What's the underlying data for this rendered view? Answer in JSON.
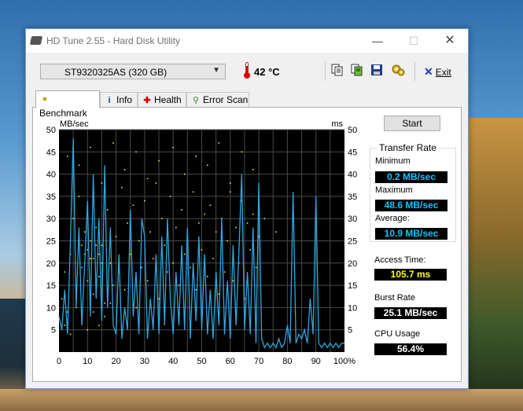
{
  "window": {
    "title": "HD Tune 2.55 - Hard Disk Utility",
    "min_glyph": "—",
    "max_glyph": "☐",
    "close_glyph": "✕"
  },
  "toolbar": {
    "drive": "ST9320325AS (320 GB)",
    "temperature": "42 °C",
    "exit_label": "Exit",
    "icons": [
      "copy-text-icon",
      "copy-screenshot-icon",
      "save-icon",
      "options-icon"
    ]
  },
  "tabs": [
    {
      "label": "Benchmark",
      "icon": "lightbulb-icon",
      "active": true
    },
    {
      "label": "Info",
      "icon": "info-icon",
      "active": false
    },
    {
      "label": "Health",
      "icon": "health-cross-icon",
      "active": false
    },
    {
      "label": "Error Scan",
      "icon": "magnifier-icon",
      "active": false
    }
  ],
  "benchmark": {
    "start_label": "Start",
    "transfer_rate_title": "Transfer Rate",
    "minimum_label": "Minimum",
    "minimum_value": "0.2 MB/sec",
    "maximum_label": "Maximum",
    "maximum_value": "48.6 MB/sec",
    "average_label": "Average:",
    "average_value": "10.9 MB/sec",
    "access_time_label": "Access Time:",
    "access_time_value": "105.7 ms",
    "burst_rate_label": "Burst Rate",
    "burst_rate_value": "25.1 MB/sec",
    "cpu_usage_label": "CPU Usage",
    "cpu_usage_value": "56.4%"
  },
  "colors": {
    "transfer_line": "#2ea8e0",
    "access_dots": "#e8e85a",
    "grid": "#4a4a4a",
    "value_blue": "#00c8ff",
    "value_yellow": "#ffff00"
  },
  "chart_data": {
    "type": "line",
    "y_left_label": "MB/sec",
    "y_right_label": "ms",
    "ylim": [
      0,
      50
    ],
    "y_right_lim": [
      0,
      50
    ],
    "xlim": [
      0,
      100
    ],
    "y_ticks": [
      "5",
      "10",
      "15",
      "20",
      "25",
      "30",
      "35",
      "40",
      "45",
      "50"
    ],
    "y_right_ticks": [
      "5",
      "10",
      "15",
      "20",
      "25",
      "30",
      "35",
      "40",
      "45",
      "50"
    ],
    "x_ticks": [
      "0",
      "10",
      "20",
      "30",
      "40",
      "50",
      "60",
      "70",
      "80",
      "90",
      "100%"
    ],
    "grid": true,
    "series": [
      {
        "name": "Transfer Rate",
        "points": [
          [
            0,
            8
          ],
          [
            1,
            5
          ],
          [
            2,
            14
          ],
          [
            3,
            4
          ],
          [
            4,
            25
          ],
          [
            5,
            48
          ],
          [
            6,
            10
          ],
          [
            7,
            28
          ],
          [
            8,
            6
          ],
          [
            9,
            20
          ],
          [
            10,
            34
          ],
          [
            11,
            8
          ],
          [
            12,
            40
          ],
          [
            13,
            12
          ],
          [
            14,
            30
          ],
          [
            15,
            7
          ],
          [
            16,
            42
          ],
          [
            17,
            10
          ],
          [
            18,
            28
          ],
          [
            19,
            6
          ],
          [
            20,
            4
          ],
          [
            21,
            22
          ],
          [
            22,
            3
          ],
          [
            23,
            10
          ],
          [
            24,
            5
          ],
          [
            25,
            32
          ],
          [
            26,
            8
          ],
          [
            27,
            18
          ],
          [
            28,
            4
          ],
          [
            29,
            30
          ],
          [
            30,
            26
          ],
          [
            31,
            3
          ],
          [
            32,
            12
          ],
          [
            33,
            5
          ],
          [
            34,
            22
          ],
          [
            35,
            4
          ],
          [
            36,
            26
          ],
          [
            37,
            6
          ],
          [
            38,
            30
          ],
          [
            39,
            12
          ],
          [
            40,
            4
          ],
          [
            41,
            18
          ],
          [
            42,
            6
          ],
          [
            43,
            24
          ],
          [
            44,
            5
          ],
          [
            45,
            28
          ],
          [
            46,
            3
          ],
          [
            47,
            20
          ],
          [
            48,
            7
          ],
          [
            49,
            26
          ],
          [
            50,
            5
          ],
          [
            51,
            22
          ],
          [
            52,
            4
          ],
          [
            53,
            14
          ],
          [
            54,
            3
          ],
          [
            55,
            18
          ],
          [
            56,
            6
          ],
          [
            57,
            30
          ],
          [
            58,
            4
          ],
          [
            59,
            16
          ],
          [
            60,
            3
          ],
          [
            61,
            24
          ],
          [
            62,
            6
          ],
          [
            63,
            22
          ],
          [
            64,
            40
          ],
          [
            65,
            5
          ],
          [
            66,
            18
          ],
          [
            67,
            4
          ],
          [
            68,
            28
          ],
          [
            69,
            2
          ],
          [
            70,
            38
          ],
          [
            71,
            3
          ],
          [
            72,
            1
          ],
          [
            73,
            2
          ],
          [
            74,
            1
          ],
          [
            75,
            2
          ],
          [
            76,
            1
          ],
          [
            77,
            3
          ],
          [
            78,
            1
          ],
          [
            79,
            2
          ],
          [
            80,
            6
          ],
          [
            81,
            2
          ],
          [
            82,
            36
          ],
          [
            83,
            2
          ],
          [
            84,
            4
          ],
          [
            85,
            3
          ],
          [
            86,
            5
          ],
          [
            87,
            2
          ],
          [
            88,
            12
          ],
          [
            89,
            4
          ],
          [
            90,
            35
          ],
          [
            91,
            2
          ],
          [
            92,
            1
          ],
          [
            93,
            2
          ],
          [
            94,
            1
          ],
          [
            95,
            2
          ],
          [
            96,
            1
          ],
          [
            97,
            2
          ],
          [
            98,
            1
          ],
          [
            99,
            2
          ],
          [
            100,
            2
          ]
        ]
      },
      {
        "name": "Access Time",
        "points": [
          [
            1,
            12
          ],
          [
            2,
            18
          ],
          [
            3,
            9
          ],
          [
            4,
            22
          ],
          [
            5,
            30
          ],
          [
            6,
            14
          ],
          [
            7,
            35
          ],
          [
            8,
            19
          ],
          [
            9,
            27
          ],
          [
            10,
            16
          ],
          [
            11,
            21
          ],
          [
            12,
            13
          ],
          [
            13,
            28
          ],
          [
            14,
            17
          ],
          [
            15,
            24
          ],
          [
            16,
            11
          ],
          [
            17,
            32
          ],
          [
            18,
            20
          ],
          [
            19,
            15
          ],
          [
            20,
            26
          ],
          [
            21,
            18
          ],
          [
            22,
            37
          ],
          [
            23,
            14
          ],
          [
            24,
            29
          ],
          [
            25,
            22
          ],
          [
            26,
            33
          ],
          [
            27,
            10
          ],
          [
            28,
            25
          ],
          [
            29,
            19
          ],
          [
            30,
            34
          ],
          [
            31,
            16
          ],
          [
            32,
            27
          ],
          [
            33,
            21
          ],
          [
            34,
            38
          ],
          [
            35,
            12
          ],
          [
            36,
            30
          ],
          [
            37,
            24
          ],
          [
            38,
            18
          ],
          [
            39,
            35
          ],
          [
            40,
            20
          ],
          [
            41,
            28
          ],
          [
            42,
            15
          ],
          [
            43,
            32
          ],
          [
            44,
            22
          ],
          [
            45,
            26
          ],
          [
            46,
            19
          ],
          [
            47,
            36
          ],
          [
            48,
            14
          ],
          [
            49,
            29
          ],
          [
            50,
            23
          ],
          [
            51,
            31
          ],
          [
            52,
            17
          ],
          [
            53,
            33
          ],
          [
            54,
            21
          ],
          [
            55,
            27
          ],
          [
            56,
            13
          ],
          [
            57,
            30
          ],
          [
            58,
            18
          ],
          [
            59,
            25
          ],
          [
            60,
            36
          ],
          [
            61,
            16
          ],
          [
            62,
            28
          ],
          [
            63,
            20
          ],
          [
            64,
            34
          ],
          [
            65,
            12
          ],
          [
            66,
            29
          ],
          [
            67,
            23
          ],
          [
            68,
            31
          ],
          [
            69,
            19
          ],
          [
            70,
            26
          ],
          [
            3,
            44
          ],
          [
            7,
            42
          ],
          [
            11,
            46
          ],
          [
            15,
            38
          ],
          [
            19,
            47
          ],
          [
            23,
            41
          ],
          [
            27,
            45
          ],
          [
            31,
            39
          ],
          [
            35,
            43
          ],
          [
            40,
            46
          ],
          [
            44,
            40
          ],
          [
            48,
            44
          ],
          [
            52,
            42
          ],
          [
            56,
            47
          ],
          [
            60,
            38
          ],
          [
            64,
            45
          ],
          [
            68,
            41
          ],
          [
            72,
            30
          ],
          [
            76,
            27
          ],
          [
            2,
            6
          ],
          [
            4,
            4
          ],
          [
            6,
            10
          ],
          [
            8,
            7
          ],
          [
            10,
            5
          ],
          [
            12,
            9
          ],
          [
            14,
            6
          ],
          [
            16,
            8
          ],
          [
            18,
            11
          ],
          [
            8,
            24
          ],
          [
            9,
            22
          ],
          [
            10,
            23
          ],
          [
            11,
            25
          ],
          [
            12,
            21
          ],
          [
            13,
            24
          ],
          [
            14,
            22
          ],
          [
            15,
            20
          ]
        ]
      }
    ]
  }
}
